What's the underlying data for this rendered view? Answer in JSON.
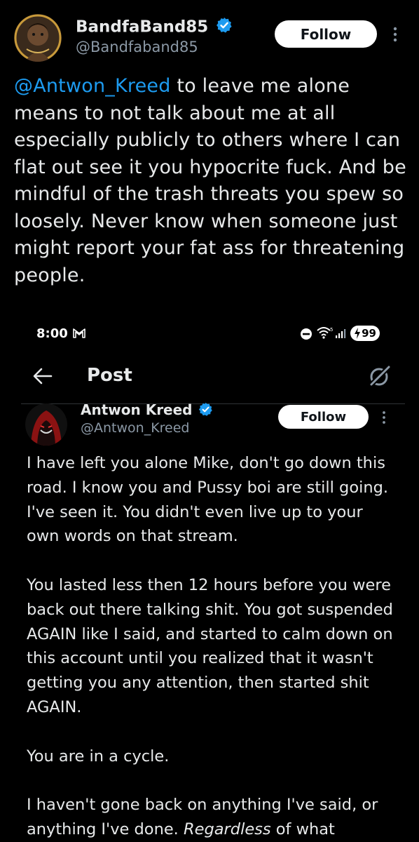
{
  "top_tweet": {
    "display_name": "BandfaBand85",
    "handle": "@Bandfaband85",
    "follow_label": "Follow",
    "mention": "@Antwon_Kreed",
    "text": " to leave me alone means to not talk about me at all especially publicly to others where I can flat out see it you hypocrite fuck. And be mindful of the trash threats you spew so loosely. Never know when someone just might report your fat ass for threatening people."
  },
  "status_bar": {
    "time": "8:00",
    "mail_icon": "gmail-icon",
    "battery": "99"
  },
  "post_header": {
    "title": "Post"
  },
  "bottom_tweet": {
    "display_name": "Antwon Kreed",
    "handle": "@Antwon_Kreed",
    "follow_label": "Follow",
    "paragraphs": [
      "I have left you alone Mike, don't go down this road. I know you and Pussy boi are still going. I've seen it. You didn't even live up to your own words on that stream.",
      "You lasted less then 12 hours before you were back out there talking shit. You got suspended AGAIN like I said, and started to calm down on this account until you realized that it wasn't getting you any attention, then started shit AGAIN.",
      "You are in a cycle."
    ],
    "last_paragraph_start": "I haven't gone back on anything I've said, or anything I've done. ",
    "last_paragraph_emphasis": "Regardless",
    "last_paragraph_end": " of what"
  },
  "colors": {
    "background": "#000000",
    "text": "#e7e9ea",
    "secondary": "#8b98a5",
    "accent": "#1d9bf0"
  }
}
